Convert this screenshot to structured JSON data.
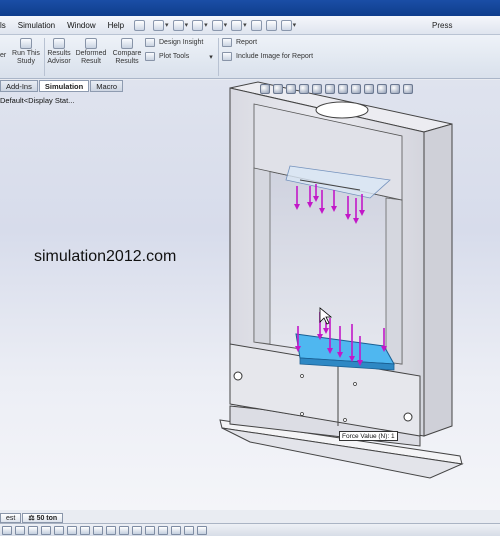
{
  "menu": {
    "items": [
      "ls",
      "Simulation",
      "Window",
      "Help"
    ],
    "right_text": "Press"
  },
  "ribbon": {
    "left_cut": "er",
    "run_study": [
      "Run This",
      "Study"
    ],
    "results_advisor": [
      "Results",
      "Advisor"
    ],
    "deformed_result": [
      "Deformed",
      "Result"
    ],
    "compare_results": [
      "Compare",
      "Results"
    ],
    "design_insight": "Design Insight",
    "plot_tools": "Plot Tools",
    "report": "Report",
    "include_image": "Include Image for Report"
  },
  "tabs": [
    "Add-Ins",
    "Simulation",
    "Macro"
  ],
  "active_tab": "Simulation",
  "tree": {
    "config_label": "Default<Display Stat..."
  },
  "watermark": "simulation2012.com",
  "force_label": "Force Value (N): 1",
  "bottom_tabs": [
    "est",
    "50 ton"
  ],
  "colors": {
    "title_blue": "#1a4ea6",
    "load_arrow": "#c218c8",
    "load_face": "#4fb7f0",
    "frame_fill": "#e2e3ea",
    "frame_edge": "#4a4a55"
  }
}
